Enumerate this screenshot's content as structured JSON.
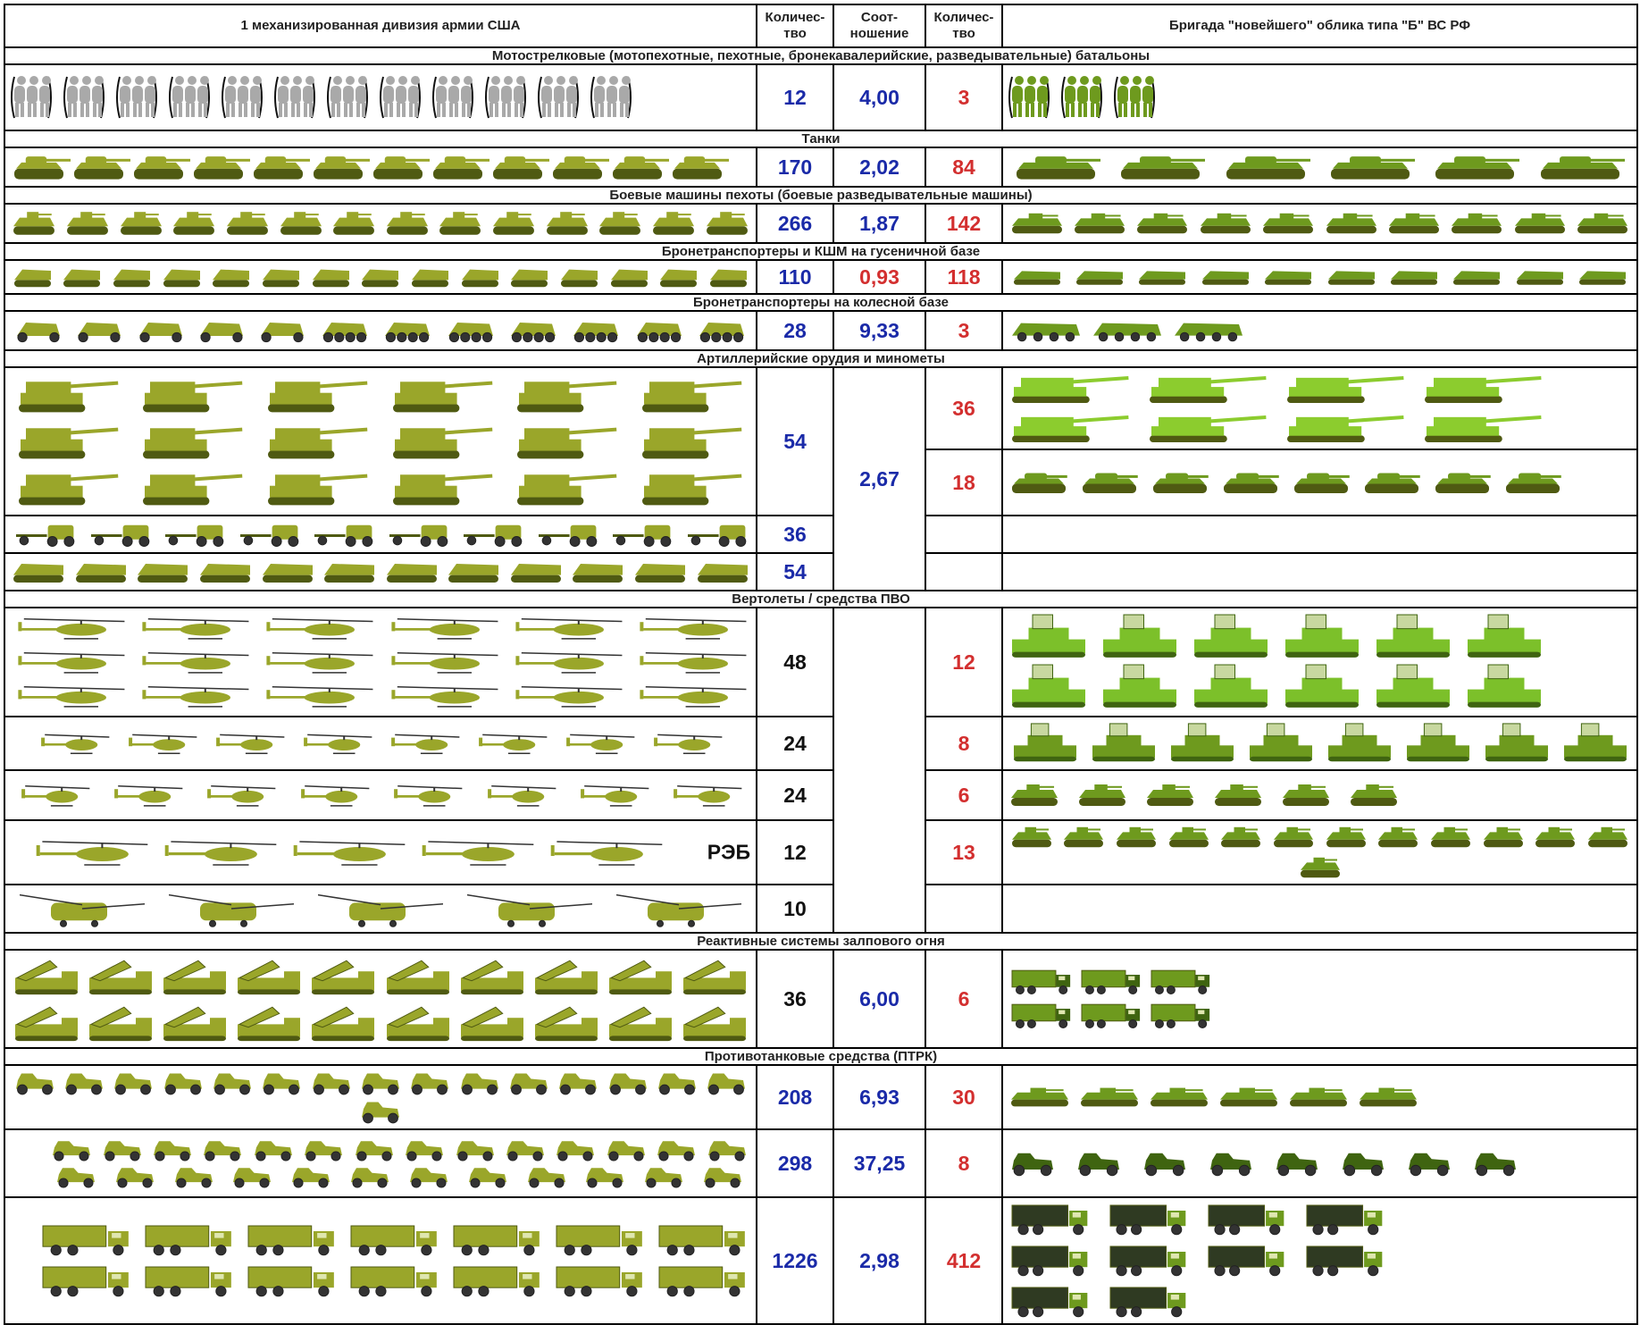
{
  "header": {
    "us_title": "1 механизированная дивизия армии США",
    "col_count_us": "Количес-тво",
    "col_ratio": "Соот-ношение",
    "col_count_ru": "Количес-тво",
    "ru_title": "Бригада \"новейшего\" облика типа \"Б\"  ВС РФ"
  },
  "colors": {
    "us_olive": "#9aa62a",
    "ru_green": "#6e9a1e",
    "infantry_grey": "#a9a9a9",
    "blue_number": "#1a2aa8",
    "red_number": "#d32f2f"
  },
  "sections": {
    "infantry": "Мотострелковые (мотопехотные, пехотные, бронекавалерийские, разведывательные) батальоны",
    "tanks": "Танки",
    "ifv": "Боевые машины пехоты (боевые разведывательные машины)",
    "tracked_apc": "Бронетранспортеры и КШМ на гусеничной базе",
    "wheeled_apc": "Бронетранспортеры на колесной базе",
    "artillery": "Артиллерийские орудия и минометы",
    "heli_ad": "Вертолеты / средства ПВО",
    "mlrs": "Реактивные системы залпового огня",
    "at": "Противотанковые средства (ПТРК)"
  },
  "rows": {
    "infantry": {
      "us": "12",
      "ratio": "4,00",
      "ru": "3",
      "us_icons": "infantry-battalion-icon",
      "ru_icons": "ru-infantry-battalion-icon"
    },
    "tanks": {
      "us": "170",
      "ratio": "2,02",
      "ru": "84",
      "us_icons": "us-tank-icon",
      "ru_icons": "ru-tank-icon"
    },
    "ifv": {
      "us": "266",
      "ratio": "1,87",
      "ru": "142",
      "us_icons": "us-ifv-icon",
      "ru_icons": "ru-ifv-icon"
    },
    "tracked_apc": {
      "us": "110",
      "ratio": "0,93",
      "ru": "118",
      "us_icons": "us-tracked-apc-icon",
      "ru_icons": "ru-tracked-apc-icon"
    },
    "wheeled_apc": {
      "us": "28",
      "ratio": "9,33",
      "ru": "3",
      "us_icons": "us-wheeled-apc-icon",
      "ru_icons": "ru-btr-icon"
    },
    "artillery_sp": {
      "us": "54",
      "ratio": "2,67",
      "ru_a": "36",
      "ru_b": "18",
      "us_icons": "us-sp-howitzer-icon",
      "ru_icons_a": "ru-sp-howitzer-icon",
      "ru_icons_b": "ru-sp-mortar-icon"
    },
    "artillery_towed": {
      "us": "36",
      "us_icons": "towed-howitzer-icon"
    },
    "artillery_mortar": {
      "us": "54",
      "us_icons": "mortar-carrier-icon"
    },
    "heli_1": {
      "us": "48",
      "ru": "12",
      "us_icons": "blackhawk-helicopter-icon",
      "ru_icons": "ru-sam-launcher-icon"
    },
    "heli_2": {
      "us": "24",
      "ru": "8",
      "us_icons": "apache-helicopter-icon",
      "ru_icons": "ru-tunguska-icon"
    },
    "heli_3": {
      "us": "24",
      "ru": "6",
      "us_icons": "kiowa-helicopter-icon",
      "ru_icons": "ru-strela-icon"
    },
    "heli_4": {
      "us": "12",
      "reb": "РЭБ",
      "ru": "13",
      "us_icons": "ew-helicopter-icon",
      "ru_icons": "ru-mtlb-ad-icon"
    },
    "heli_5": {
      "us": "10",
      "us_icons": "chinook-helicopter-icon"
    },
    "mlrs": {
      "us": "36",
      "ratio": "6,00",
      "ru": "6",
      "us_icons": "mlrs-launcher-icon",
      "ru_icons": "ru-grad-truck-icon"
    },
    "at_1": {
      "us": "208",
      "ratio": "6,93",
      "ru": "30",
      "us_icons": "humvee-tow-icon",
      "ru_icons": "ru-at-vehicle-icon"
    },
    "at_2": {
      "us": "298",
      "ratio": "37,25",
      "ru": "8",
      "us_icons": "humvee-icon",
      "ru_icons": "ru-tigr-icon"
    },
    "trucks": {
      "us": "1226",
      "ratio": "2,98",
      "ru": "412",
      "us_icons": "us-truck-icon",
      "ru_icons": "ru-kamaz-truck-icon"
    }
  }
}
